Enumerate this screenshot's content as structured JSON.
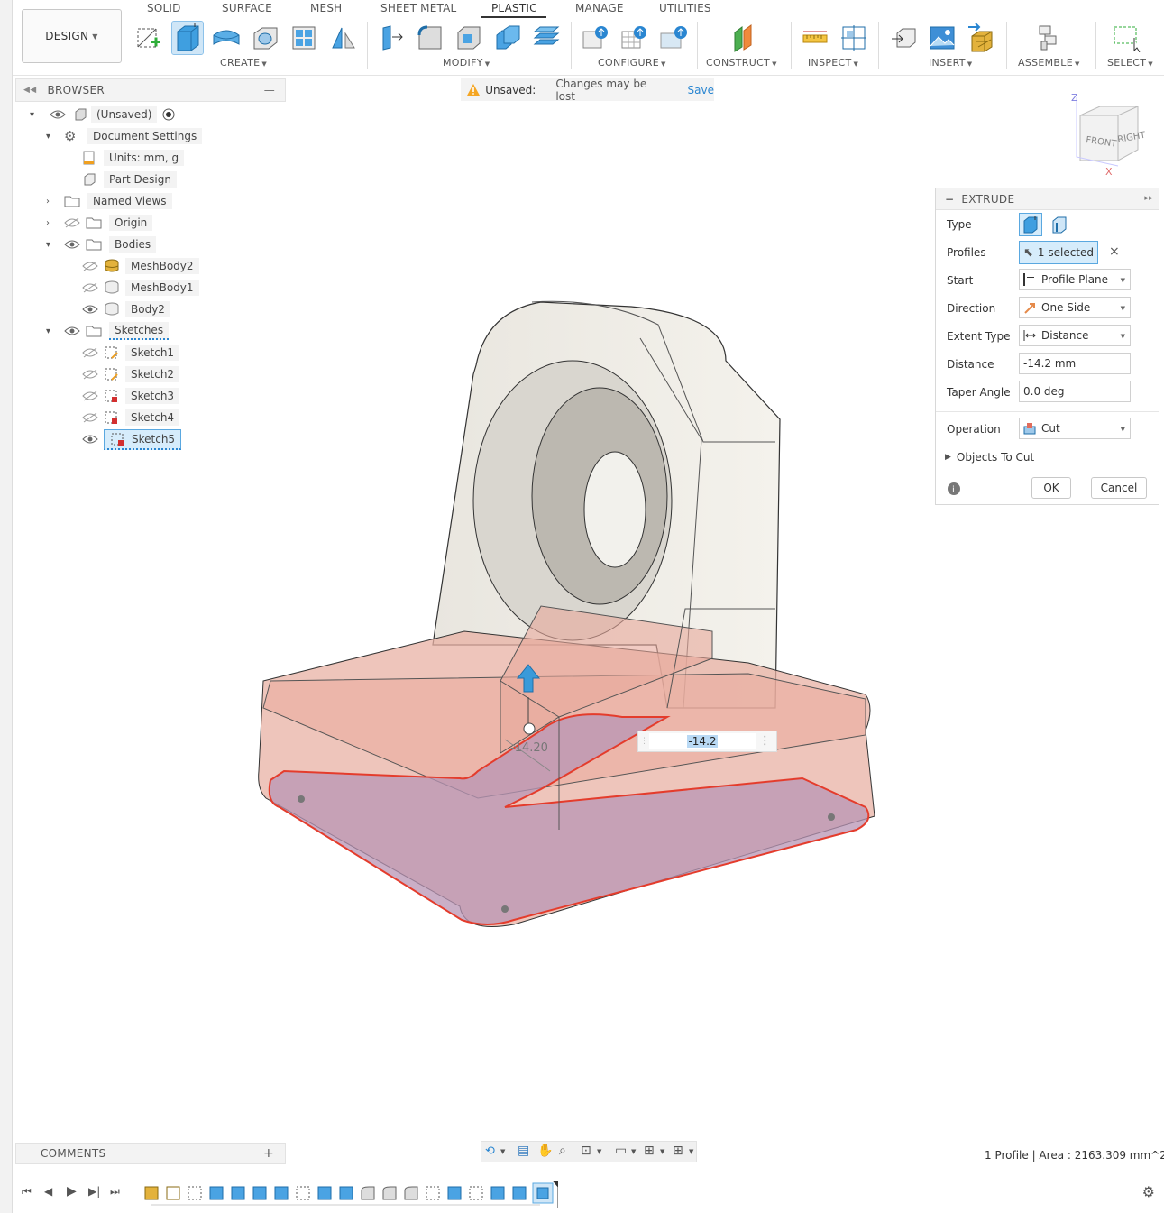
{
  "workspace": {
    "label": "DESIGN"
  },
  "tabs": [
    {
      "label": "SOLID"
    },
    {
      "label": "SURFACE"
    },
    {
      "label": "MESH"
    },
    {
      "label": "SHEET METAL"
    },
    {
      "label": "PLASTIC"
    },
    {
      "label": "MANAGE"
    },
    {
      "label": "UTILITIES"
    }
  ],
  "active_tab": "PLASTIC",
  "groups": {
    "create": "CREATE",
    "modify": "MODIFY",
    "configure": "CONFIGURE",
    "construct": "CONSTRUCT",
    "inspect": "INSPECT",
    "insert": "INSERT",
    "assemble": "ASSEMBLE",
    "select": "SELECT"
  },
  "browser": {
    "title": "BROWSER",
    "root": "(Unsaved)",
    "document_settings": "Document Settings",
    "units": "Units: mm, g",
    "part_design": "Part Design",
    "named_views": "Named Views",
    "origin": "Origin",
    "bodies": "Bodies",
    "body_items": [
      "MeshBody2",
      "MeshBody1",
      "Body2"
    ],
    "sketches": "Sketches",
    "sketch_items": [
      "Sketch1",
      "Sketch2",
      "Sketch3",
      "Sketch4",
      "Sketch5"
    ]
  },
  "unsaved": {
    "title": "Unsaved:",
    "message": "Changes may be lost",
    "save": "Save"
  },
  "viewcube": {
    "front": "FRONT",
    "right": "RIGHT",
    "z": "Z",
    "x": "X"
  },
  "viewport": {
    "dimension_label": "-14.20",
    "input_value": "-14.2"
  },
  "extrude": {
    "title": "EXTRUDE",
    "type_label": "Type",
    "profiles_label": "Profiles",
    "profiles_value": "1 selected",
    "start_label": "Start",
    "start_value": "Profile Plane",
    "direction_label": "Direction",
    "direction_value": "One Side",
    "extent_label": "Extent Type",
    "extent_value": "Distance",
    "distance_label": "Distance",
    "distance_value": "-14.2 mm",
    "taper_label": "Taper Angle",
    "taper_value": "0.0 deg",
    "operation_label": "Operation",
    "operation_value": "Cut",
    "objects_to_cut": "Objects To Cut",
    "ok": "OK",
    "cancel": "Cancel"
  },
  "comments": {
    "label": "COMMENTS"
  },
  "status": {
    "text": "1 Profile | Area : 2163.309 mm^2"
  },
  "colors": {
    "accent": "#2a86d1",
    "selection_fill": "#d6ecfb",
    "cut_red": "#e0563f"
  }
}
